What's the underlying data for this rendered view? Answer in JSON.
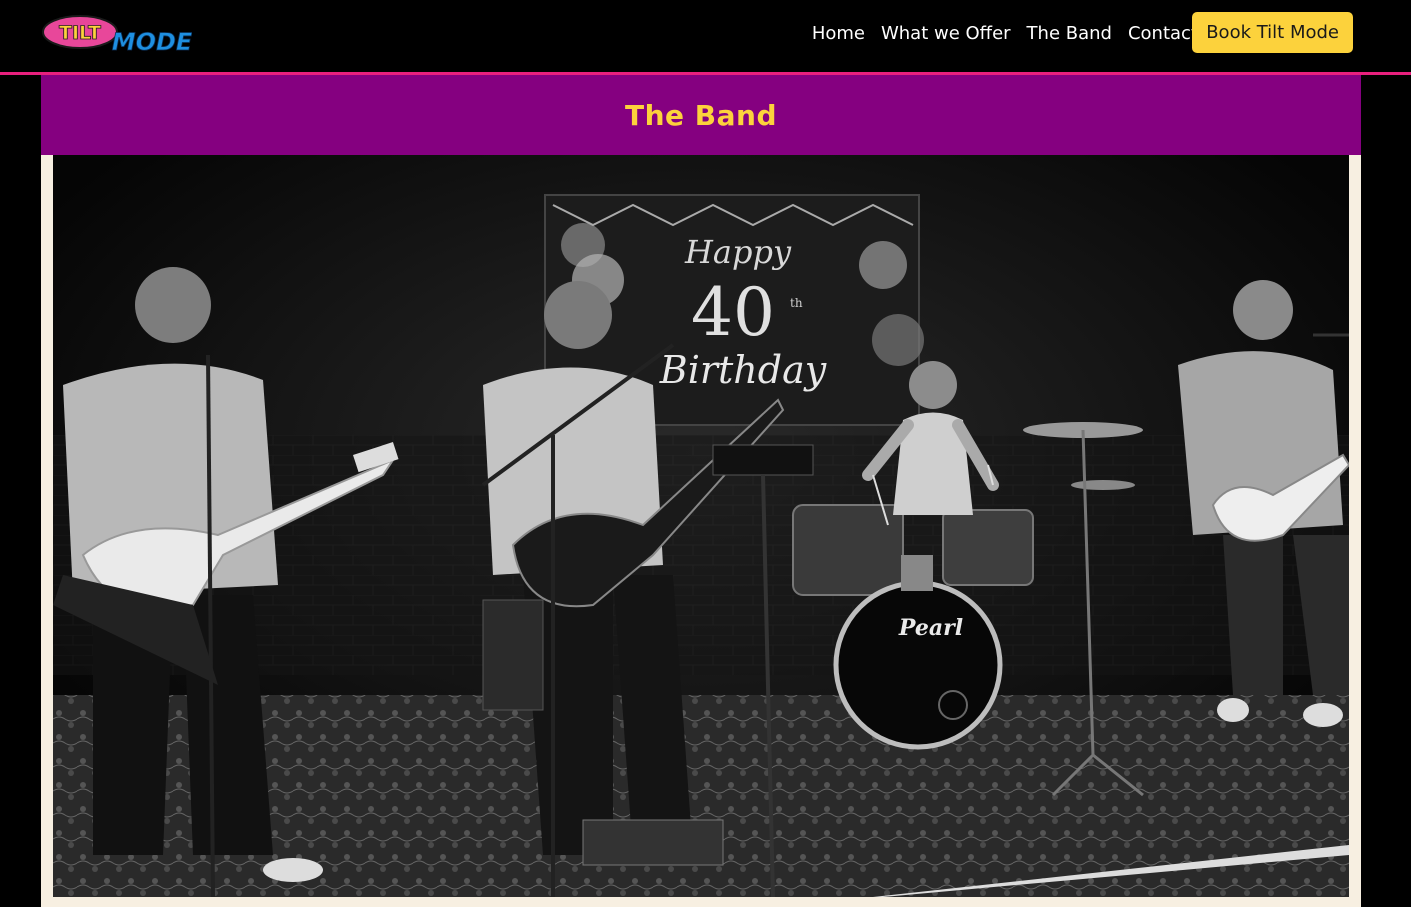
{
  "logo": {
    "text_top": "TILT",
    "text_bottom": "MODE",
    "colors": {
      "pink": "#e8479a",
      "blue": "#1e8fe0",
      "yellow": "#fcd23c"
    }
  },
  "nav": {
    "links": [
      {
        "label": "Home"
      },
      {
        "label": "What we Offer"
      },
      {
        "label": "The Band"
      },
      {
        "label": "Contact"
      }
    ],
    "cta_label": "Book Tilt Mode"
  },
  "section": {
    "title": "The Band"
  },
  "photo": {
    "banner_line1": "Happy",
    "banner_line2": "40",
    "banner_suffix": "th",
    "banner_line3": "Birthday",
    "drum_brand": "Pearl"
  },
  "colors": {
    "accent_pink": "#e8207e",
    "header_purple": "#850080",
    "accent_yellow": "#fcd23c",
    "cream": "#f7efe1"
  }
}
